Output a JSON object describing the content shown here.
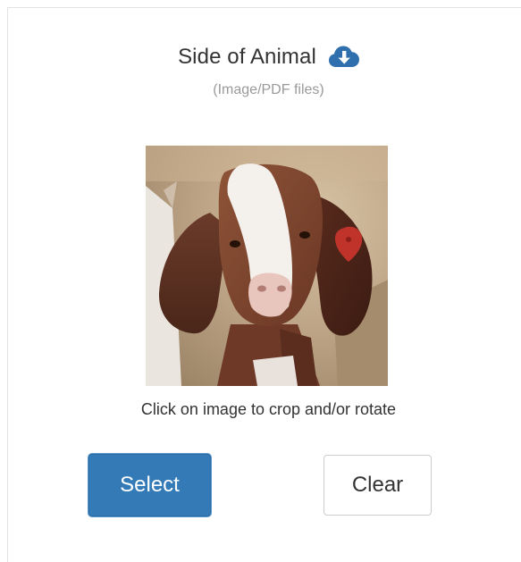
{
  "upload": {
    "title": "Side of Animal",
    "file_types": "(Image/PDF files)",
    "hint": "Click on image to crop and/or rotate",
    "icon": "cloud-download-icon",
    "photo_alt": "goat photo"
  },
  "actions": {
    "select_label": "Select",
    "clear_label": "Clear"
  },
  "colors": {
    "primary": "#337ab7",
    "icon": "#2f6fae",
    "muted_text": "#9a9a9a",
    "text": "#333333"
  }
}
